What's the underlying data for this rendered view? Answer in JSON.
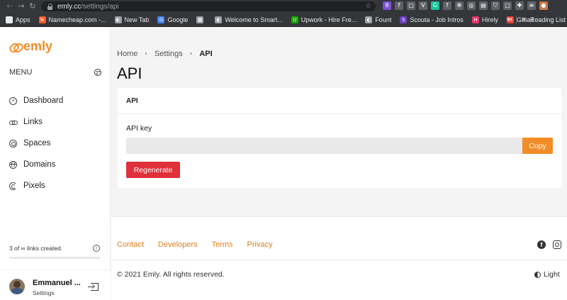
{
  "browser": {
    "url_host": "emly.cc",
    "url_path": "/settings/api",
    "extensions": [
      {
        "name": "extension-1-icon",
        "color": "#7a52d6",
        "glyph": "8"
      },
      {
        "name": "extension-2-icon",
        "color": "#5f6368",
        "glyph": "f"
      },
      {
        "name": "extension-3-icon",
        "color": "#5f6368",
        "glyph": "▢"
      },
      {
        "name": "extension-4-icon",
        "color": "#5f6368",
        "glyph": "V"
      },
      {
        "name": "grammarly-icon",
        "color": "#15c39a",
        "glyph": "G"
      },
      {
        "name": "extension-6-icon",
        "color": "#5f6368",
        "glyph": "f"
      },
      {
        "name": "extension-7-icon",
        "color": "#5f6368",
        "glyph": "✻"
      },
      {
        "name": "extension-8-icon",
        "color": "#5f6368",
        "glyph": "◎"
      },
      {
        "name": "extension-9-icon",
        "color": "#5f6368",
        "glyph": "▤"
      },
      {
        "name": "shield-ext-icon",
        "color": "#5f6368",
        "glyph": "⛉"
      },
      {
        "name": "extension-11-icon",
        "color": "#5f6368",
        "glyph": "▢"
      },
      {
        "name": "puzzle-icon",
        "color": "#5f6368",
        "glyph": "✚"
      },
      {
        "name": "extension-13-icon",
        "color": "#5f6368",
        "glyph": "≡"
      },
      {
        "name": "profile-icon",
        "color": "#c27a45",
        "glyph": "●"
      }
    ]
  },
  "bookmarks": {
    "items": [
      {
        "name": "bookmark-apps",
        "label": "Apps",
        "icon_color": "#e8eaed",
        "glyph": "⋮"
      },
      {
        "name": "bookmark-namecheap",
        "label": "Namecheap.com -...",
        "icon_color": "#f05a28",
        "glyph": "N"
      },
      {
        "name": "bookmark-new-tab",
        "label": "New Tab",
        "icon_color": "#9aa0a6",
        "glyph": "◐"
      },
      {
        "name": "bookmark-google",
        "label": "Google",
        "icon_color": "#4285f4",
        "glyph": "G"
      },
      {
        "name": "bookmark-grid",
        "label": "",
        "icon_color": "#9aa0a6",
        "glyph": "▦"
      },
      {
        "name": "bookmark-welcome",
        "label": "Welcome to Smart...",
        "icon_color": "#9aa0a6",
        "glyph": "◐"
      },
      {
        "name": "bookmark-upwork",
        "label": "Upwork - Hire Fre...",
        "icon_color": "#14a800",
        "glyph": "U"
      },
      {
        "name": "bookmark-fount",
        "label": "Fount",
        "icon_color": "#9aa0a6",
        "glyph": "◐"
      },
      {
        "name": "bookmark-scouta",
        "label": "Scouta - Job Intros",
        "icon_color": "#6c3fc5",
        "glyph": "S"
      },
      {
        "name": "bookmark-hirely",
        "label": "Hirely",
        "icon_color": "#e8336b",
        "glyph": "H"
      },
      {
        "name": "bookmark-gmail",
        "label": "Gmail",
        "icon_color": "#ea4335",
        "glyph": "M"
      }
    ],
    "more": "»",
    "reading_list": "Reading List"
  },
  "sidebar": {
    "logo_text": "emly",
    "menu_label": "MENU",
    "items": [
      {
        "name": "sidebar-item-dashboard",
        "icon": "dashboard-icon",
        "icon_class": "ico-dash",
        "label": "Dashboard"
      },
      {
        "name": "sidebar-item-links",
        "icon": "link-icon",
        "icon_class": "ico-link",
        "label": "Links"
      },
      {
        "name": "sidebar-item-spaces",
        "icon": "spaces-icon",
        "icon_class": "ico-space",
        "label": "Spaces"
      },
      {
        "name": "sidebar-item-domains",
        "icon": "globe-icon",
        "icon_class": "ico-globe",
        "label": "Domains"
      },
      {
        "name": "sidebar-item-pixels",
        "icon": "pixel-icon",
        "icon_class": "ico-pixel",
        "label": "Pixels"
      }
    ],
    "links_created": "3 of ∞ links created.",
    "links_progress": 0,
    "user": {
      "name": "Emmanuel ...",
      "subtitle": "Settings"
    }
  },
  "main": {
    "breadcrumb": {
      "home": "Home",
      "settings": "Settings",
      "current": "API",
      "separator": "›"
    },
    "page_title": "API",
    "card": {
      "header": "API",
      "api_key_label": "API key",
      "api_key_value": "",
      "copy_label": "Copy",
      "regenerate_label": "Regenerate"
    }
  },
  "footer": {
    "links": [
      "Contact",
      "Developers",
      "Terms",
      "Privacy"
    ],
    "copyright": "© 2021 Emly. All rights reserved.",
    "theme_label": "Light"
  },
  "colors": {
    "accent": "#f28c28",
    "danger": "#e0303c"
  }
}
